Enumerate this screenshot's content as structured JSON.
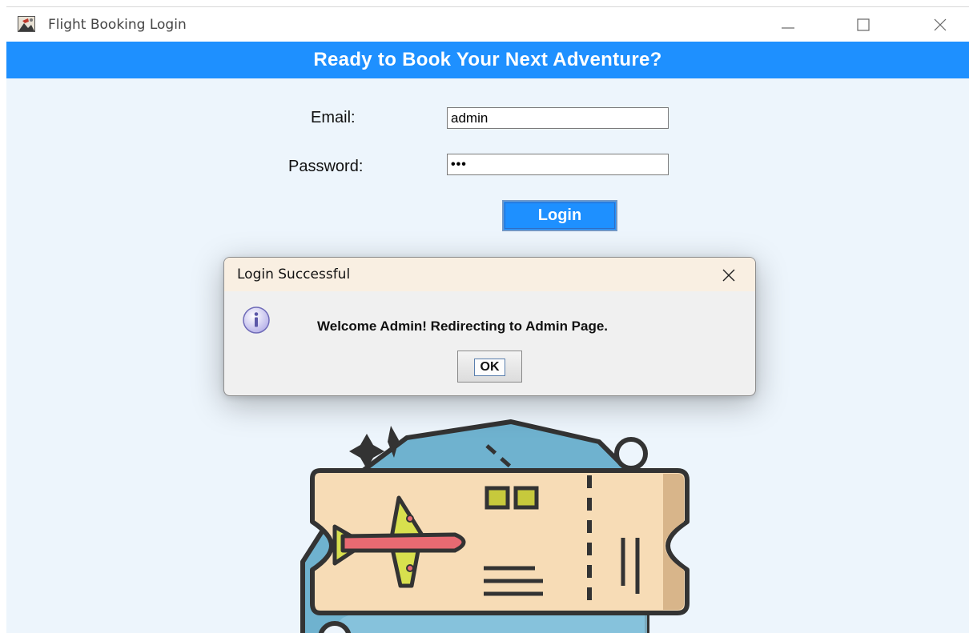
{
  "window": {
    "title": "Flight Booking Login",
    "app_icon": "flight-booking-app-icon",
    "controls": [
      "minimize-icon",
      "maximize-icon",
      "close-icon"
    ]
  },
  "banner": {
    "text": "Ready to Book Your Next Adventure?",
    "color": "#1e90ff"
  },
  "form": {
    "email_label": "Email:",
    "email_value": "admin",
    "password_label": "Password:",
    "password_value": "•••",
    "login_label": "Login"
  },
  "illustration": {
    "icon": "flight-ticket-illustration"
  },
  "dialog": {
    "title": "Login Successful",
    "icon": "info-icon",
    "message": "Welcome Admin! Redirecting to Admin Page.",
    "ok_label": "OK"
  },
  "colors": {
    "accent": "#1e90ff",
    "background": "#edf5fc",
    "dialog_header": "#f9efe2"
  }
}
